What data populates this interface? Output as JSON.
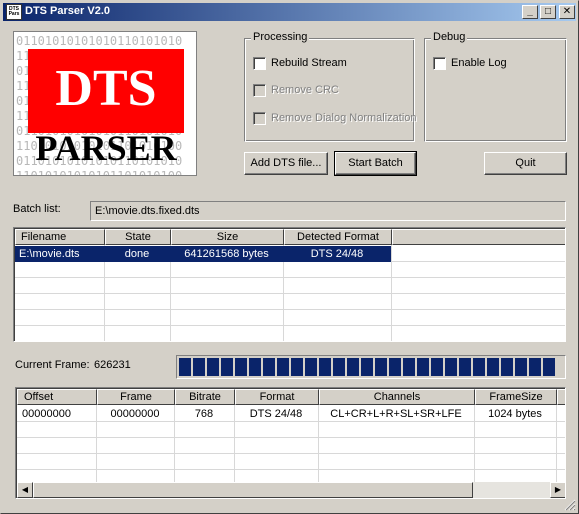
{
  "window": {
    "title": "DTS Parser V2.0",
    "app_icon_text": "DTS Pars",
    "minimize_glyph": "_",
    "maximize_glyph": "□",
    "close_glyph": "✕"
  },
  "logo": {
    "brand_top": "DTS",
    "brand_bottom": "PARSER",
    "bits_line": "01101010101010110101010"
  },
  "processing": {
    "legend": "Processing",
    "options": [
      {
        "label": "Rebuild Stream",
        "checked": false,
        "enabled": true
      },
      {
        "label": "Remove CRC",
        "checked": false,
        "enabled": false
      },
      {
        "label": "Remove Dialog Normalization",
        "checked": false,
        "enabled": false
      }
    ]
  },
  "debug": {
    "legend": "Debug",
    "options": [
      {
        "label": "Enable Log",
        "checked": false,
        "enabled": true
      }
    ]
  },
  "buttons": {
    "add": "Add DTS file...",
    "start": "Start Batch",
    "quit": "Quit"
  },
  "batch": {
    "label": "Batch list:",
    "value": "E:\\movie.dts.fixed.dts"
  },
  "batch_table": {
    "columns": [
      "Filename",
      "State",
      "Size",
      "Detected Format"
    ],
    "rows": [
      [
        "E:\\movie.dts",
        "done",
        "641261568 bytes",
        "DTS 24/48"
      ]
    ]
  },
  "current_frame": {
    "label": "Current Frame:",
    "value": "626231",
    "progress_fraction": 1.0
  },
  "frame_table": {
    "columns": [
      "Offset",
      "Frame",
      "Bitrate",
      "Format",
      "Channels",
      "FrameSize"
    ],
    "rows": [
      [
        "00000000",
        "00000000",
        "768",
        "DTS 24/48",
        "CL+CR+L+R+SL+SR+LFE",
        "1024 bytes"
      ]
    ]
  },
  "scrollbar": {
    "left_glyph": "◀",
    "right_glyph": "▶"
  },
  "colors": {
    "selection": "#0a246a",
    "logo_red": "#ff0000",
    "titlebar_start": "#0a246a",
    "titlebar_end": "#a6caf0"
  }
}
